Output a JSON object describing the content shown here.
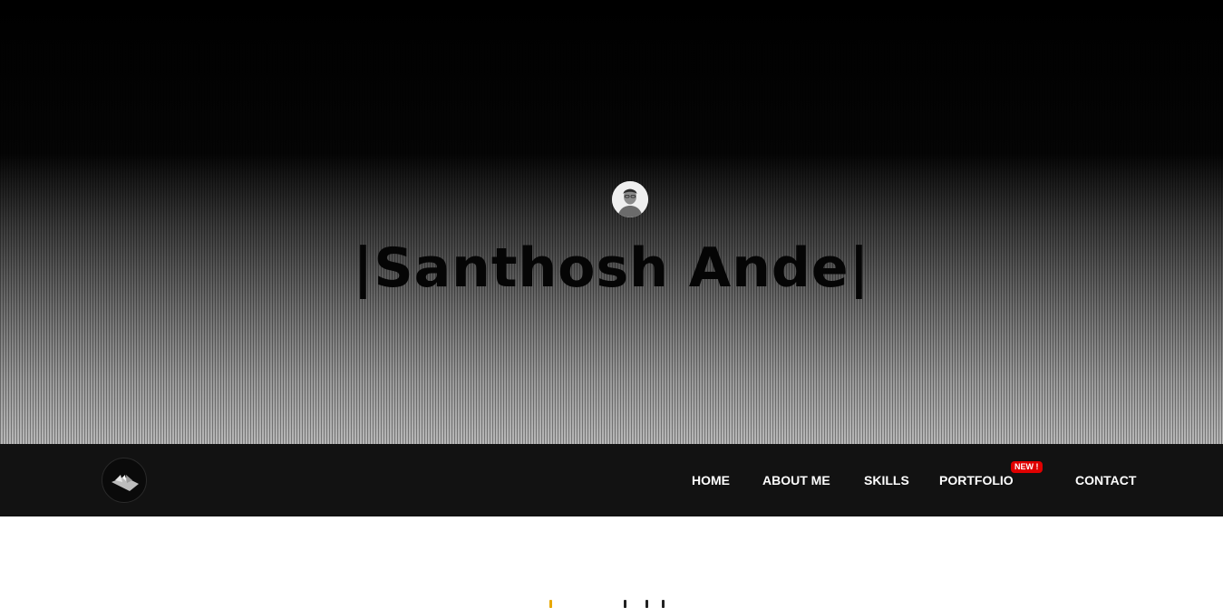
{
  "hero": {
    "title": "|Santhosh Ande|"
  },
  "nav": {
    "logo_icon": "brand-logo-icon",
    "items": [
      {
        "label": "HOME"
      },
      {
        "label": "ABOUT ME"
      },
      {
        "label": "SKILLS"
      },
      {
        "label": "PORTFOLIO",
        "badge": "NEW !"
      },
      {
        "label": "CONTACT"
      }
    ]
  },
  "colors": {
    "navbar_bg": "#121212",
    "badge_bg": "#e00000",
    "nav_text": "#ffffff"
  }
}
